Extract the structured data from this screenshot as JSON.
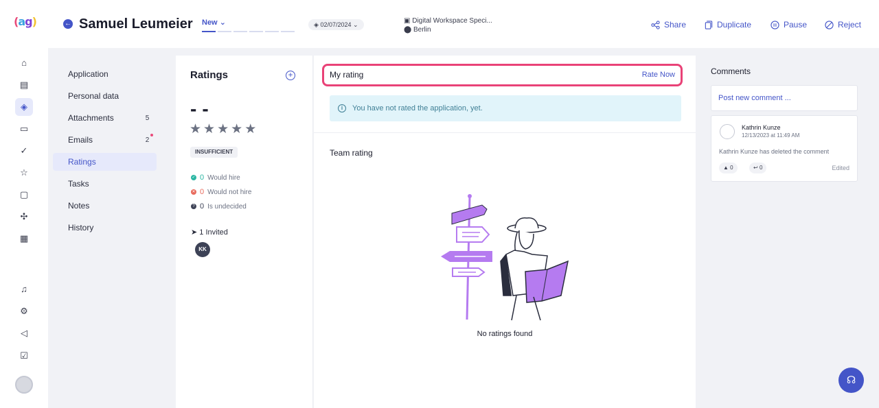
{
  "app": {
    "logo": {
      "p1": "(",
      "a": "a",
      "g": "g",
      "p2": ")"
    }
  },
  "header": {
    "candidate_name": "Samuel Leumeier",
    "stage": "New",
    "date": "02/07/2024",
    "job_title": "Digital Workspace Speci...",
    "location": "Berlin",
    "actions": {
      "share": "Share",
      "duplicate": "Duplicate",
      "pause": "Pause",
      "reject": "Reject"
    }
  },
  "leftnav": {
    "icons": [
      "home-icon",
      "briefcase-icon",
      "layers-icon",
      "presentation-icon",
      "clipboard-check-icon",
      "star-icon",
      "message-icon",
      "puzzle-icon",
      "archive-icon",
      "bell-icon",
      "gear-icon",
      "megaphone-icon",
      "checkbox-icon"
    ]
  },
  "menu": {
    "application": "Application",
    "personal_data": "Personal data",
    "attachments": "Attachments",
    "attachments_count": "5",
    "emails": "Emails",
    "emails_count": "2",
    "ratings": "Ratings",
    "tasks": "Tasks",
    "notes": "Notes",
    "history": "History"
  },
  "ratings_panel": {
    "title": "Ratings",
    "score": "--",
    "status": "INSUFFICIENT",
    "would_hire_count": "0",
    "would_hire": "Would hire",
    "would_not_hire_count": "0",
    "would_not_hire": "Would not hire",
    "undecided_count": "0",
    "undecided": "Is undecided",
    "invited": "1 Invited",
    "invitee_initials": "KK"
  },
  "main": {
    "my_rating": "My rating",
    "rate_now": "Rate Now",
    "info_text": "You have not rated the application, yet.",
    "team_rating": "Team rating",
    "no_ratings": "No ratings found"
  },
  "comments": {
    "title": "Comments",
    "post_placeholder": "Post new comment ...",
    "items": [
      {
        "author": "Kathrin Kunze",
        "date": "12/13/2023 at 11:49 AM",
        "text": "Kathrin Kunze has deleted the comment",
        "likes": "0",
        "replies": "0",
        "edited": "Edited"
      }
    ]
  },
  "colors": {
    "accent": "#4455c8",
    "highlight": "#e94277",
    "illustration": "#b57bf0"
  }
}
